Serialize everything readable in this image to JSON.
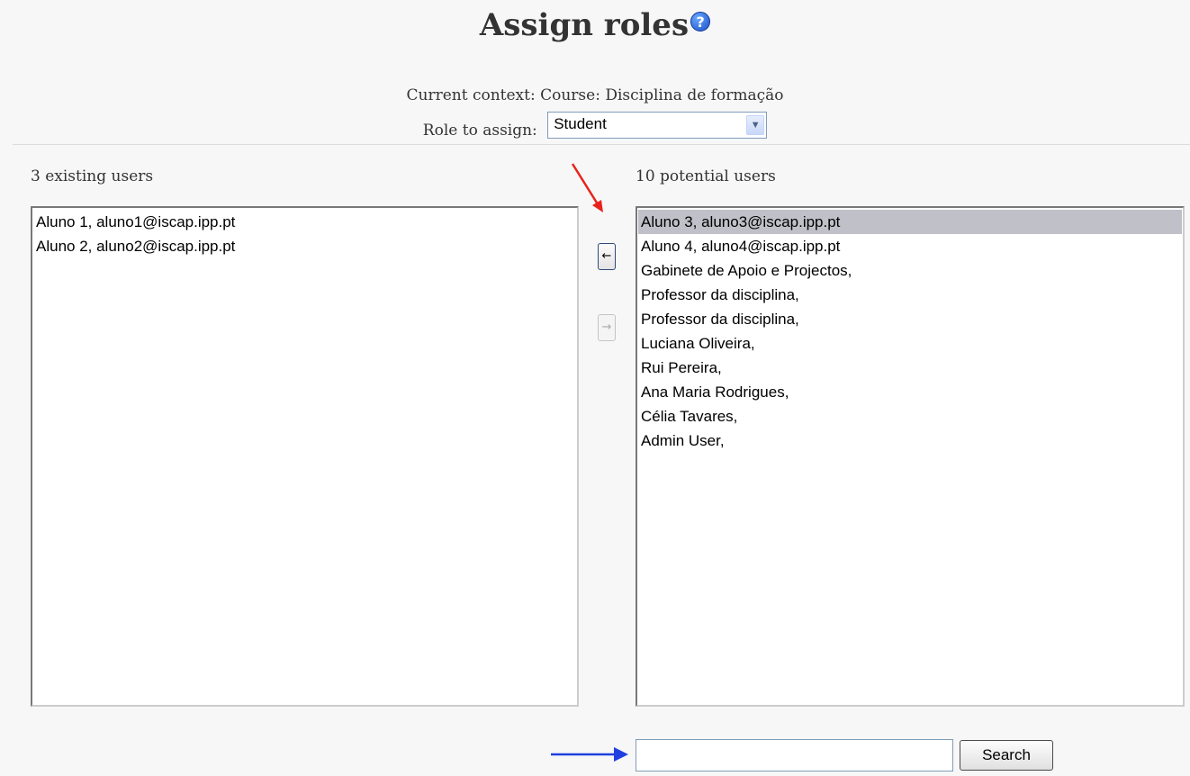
{
  "page": {
    "title": "Assign roles",
    "help_icon": "help-icon",
    "context_label": "Current context: Course: Disciplina de formação",
    "role_label": "Role to assign:",
    "role_selected": "Student"
  },
  "existing": {
    "count_label": "3 existing users",
    "items": [
      "Aluno 1, aluno1@iscap.ipp.pt",
      "Aluno 2, aluno2@iscap.ipp.pt"
    ]
  },
  "potential": {
    "count_label": "10 potential users",
    "items": [
      "Aluno 3, aluno3@iscap.ipp.pt",
      "Aluno 4, aluno4@iscap.ipp.pt",
      "Gabinete de Apoio e Projectos,",
      "Professor da disciplina,",
      "Professor da disciplina,",
      "Luciana Oliveira,",
      "Rui Pereira,",
      "Ana Maria Rodrigues,",
      "Célia Tavares,",
      "Admin User,"
    ],
    "selected_index": 0
  },
  "buttons": {
    "add": "←",
    "remove": "→",
    "search": "Search"
  },
  "search": {
    "value": ""
  },
  "annotations": {
    "red_arrow_color": "#e8231b",
    "blue_arrow_color": "#1f3fe0"
  }
}
